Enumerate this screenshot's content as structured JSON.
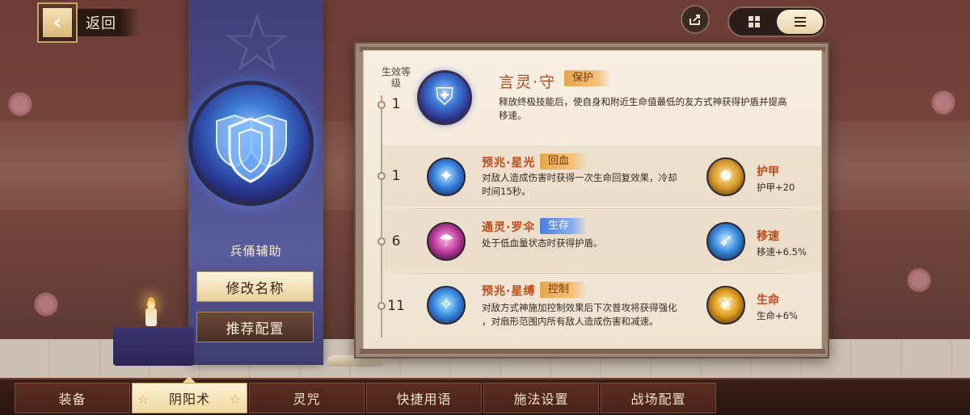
{
  "header": {
    "back_label": "返回",
    "back_icon": "chevron-left-icon",
    "share_icon": "share-icon",
    "view_toggle": {
      "grid_icon": "grid-icon",
      "list_icon": "list-icon",
      "active": "list"
    }
  },
  "loadout": {
    "title": "兵俑辅助",
    "rename_label": "修改名称",
    "recommend_label": "推荐配置",
    "emblem_icon": "shield-icon"
  },
  "panel": {
    "level_header": "生效等级",
    "main": {
      "level": "1",
      "name": "言灵·守",
      "tag": "保护",
      "desc_line1": "释放终极技能后，使自身和附近生命值最低的友方式神获得护盾并提高",
      "desc_line2": "移速。",
      "icon": "shield-icon"
    },
    "rows": [
      {
        "level": "1",
        "name": "预兆·星光",
        "tag": "回血",
        "desc_line1": "对敌人造成伤害时获得一次生命回复效果，冷却",
        "desc_line2": "时间15秒。",
        "icon": "star-icon",
        "attr_name": "护甲",
        "attr_value": "护甲+20",
        "attr_icon": "armor-icon"
      },
      {
        "level": "6",
        "name": "通灵·罗伞",
        "tag": "生存",
        "desc_line1": "处于低血量状态时获得护盾。",
        "icon": "umbrella-icon",
        "attr_name": "移速",
        "attr_value": "移速+6.5%",
        "attr_icon": "speed-icon"
      },
      {
        "level": "11",
        "name": "预兆·星缚",
        "tag": "控制",
        "desc_line1": "对敌方式神施加控制效果后下次普攻将获得强化",
        "desc_line2": "，对扇形范围内所有敌人造成伤害和减速。",
        "icon": "bind-icon",
        "attr_name": "生命",
        "attr_value": "生命+6%",
        "attr_icon": "life-icon"
      }
    ]
  },
  "tabs": [
    {
      "label": "装备",
      "active": false
    },
    {
      "label": "阴阳术",
      "active": true
    },
    {
      "label": "灵咒",
      "active": false
    },
    {
      "label": "快捷用语",
      "active": false
    },
    {
      "label": "施法设置",
      "active": false
    },
    {
      "label": "战场配置",
      "active": false
    }
  ],
  "colors": {
    "accent_orange": "#c24a16",
    "tag_orange": "#e9a64a",
    "tag_blue": "#4a7fe0",
    "banner_blue": "#4b4a8a"
  }
}
